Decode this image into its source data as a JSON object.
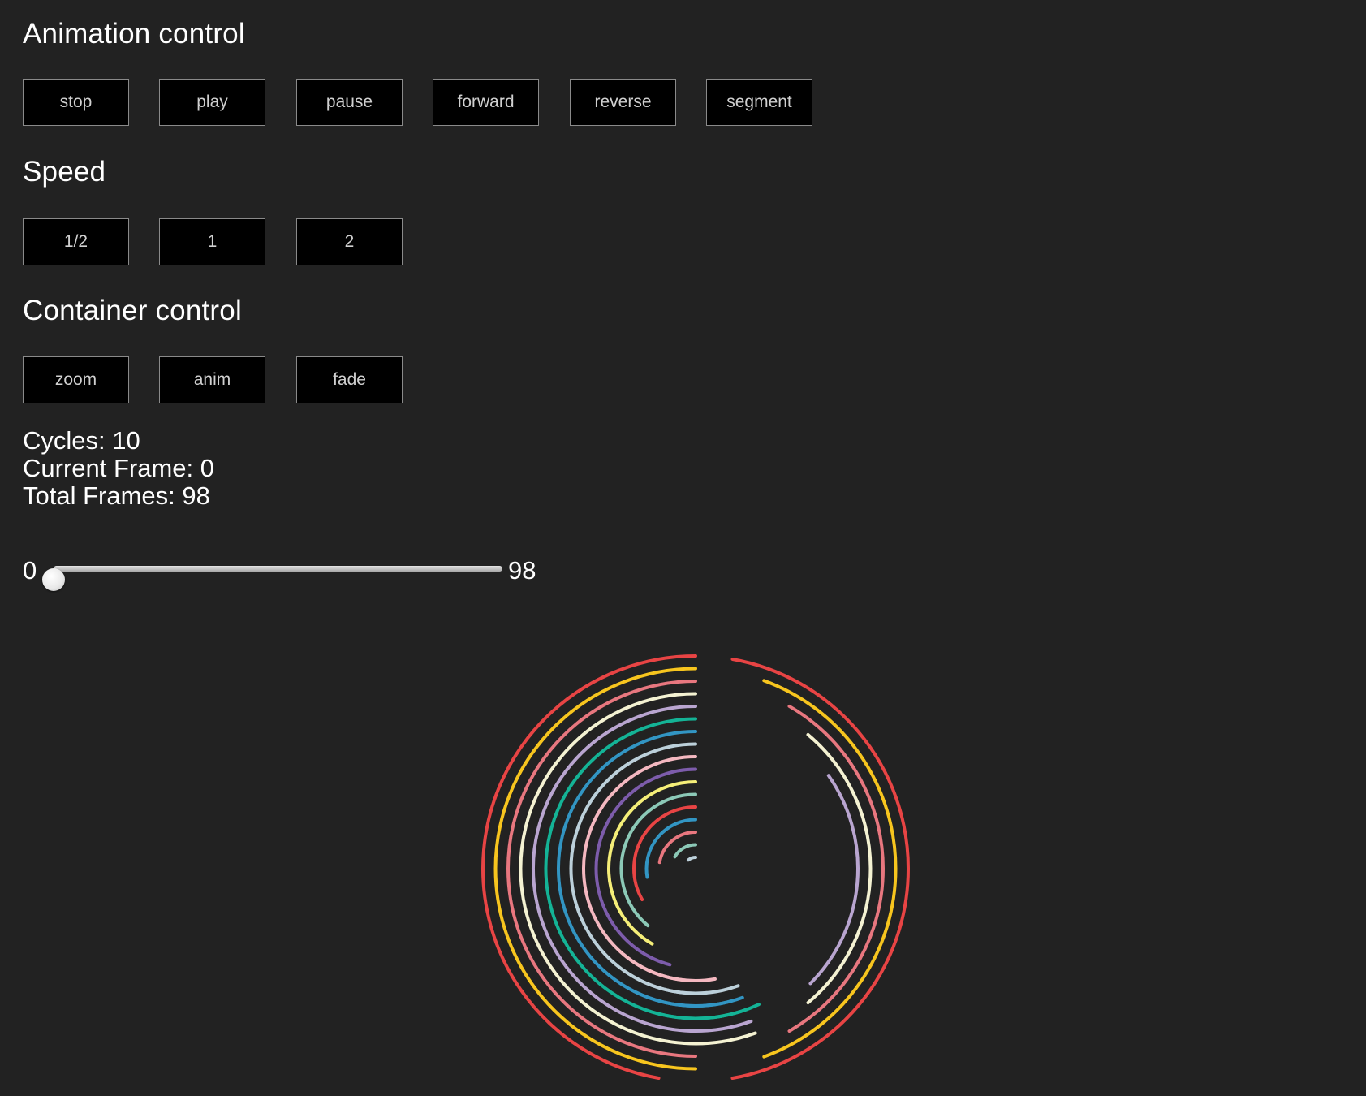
{
  "sections": {
    "animation_control": {
      "title": "Animation control",
      "buttons": [
        "stop",
        "play",
        "pause",
        "forward",
        "reverse",
        "segment"
      ]
    },
    "speed": {
      "title": "Speed",
      "buttons": [
        "1/2",
        "1",
        "2"
      ]
    },
    "container_control": {
      "title": "Container control",
      "buttons": [
        "zoom",
        "anim",
        "fade"
      ]
    }
  },
  "info": {
    "cycles": "Cycles: 10",
    "current_frame": "Current Frame: 0",
    "total_frames": "Total Frames: 98"
  },
  "slider": {
    "min_label": "0",
    "max_label": "98",
    "min": 0,
    "max": 98,
    "value": 0
  },
  "colors": {
    "background": "#222222",
    "button_bg": "#000000",
    "button_border": "#8a8a8a",
    "button_text": "#d0d0d0",
    "rings": [
      "#e84444",
      "#f7c51e",
      "#e8777f",
      "#f4f2d2",
      "#b9a5d0",
      "#14b396",
      "#3295c3",
      "#bcd0da",
      "#f4b8c0",
      "#7d5cab",
      "#f5ee78",
      "#8cc9b7",
      "#e84444",
      "#3295c3",
      "#e8777f",
      "#8cc9b7",
      "#bcd0da"
    ]
  }
}
